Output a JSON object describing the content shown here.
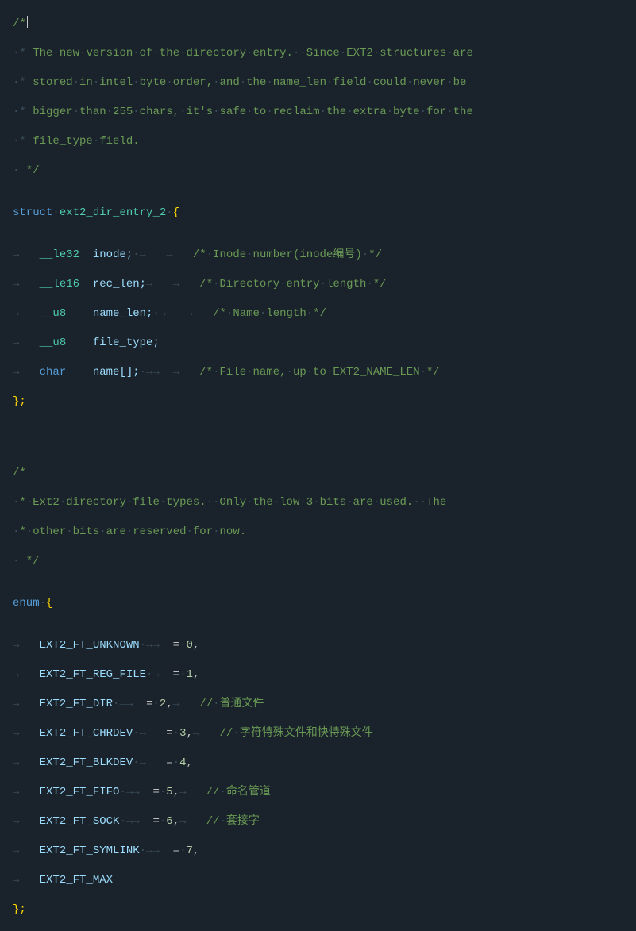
{
  "ws": {
    "dot": "·",
    "tab": "→",
    "tabs": "→→"
  },
  "cursor": "|",
  "l1": "/*",
  "l2": " * The new version of the directory entry.  Since EXT2 structures are",
  "l3": " * stored in intel byte order, and the name_len field could never be",
  "l4": " * bigger than 255 chars, it's safe to reclaim the extra byte for the",
  "l5": " * file_type field.",
  "l6": " */",
  "struct": {
    "kw_struct": "struct",
    "name": "ext2_dir_entry_2"
  },
  "brace_open": "{",
  "brace_close_semi": "};",
  "f1": {
    "type": "__le32",
    "name": "inode;",
    "cmt": "/* Inode number(inode编号) */"
  },
  "f2": {
    "type": "__le16",
    "name": "rec_len;",
    "cmt": "/* Directory entry length */"
  },
  "f3": {
    "type": "__u8",
    "name": "name_len;",
    "cmt": "/* Name length */"
  },
  "f4": {
    "type": "__u8",
    "name": "file_type;"
  },
  "f5": {
    "kw": "char",
    "name": "name[];",
    "cmt": "/* File name, up to EXT2_NAME_LEN */"
  },
  "c2l1": "/*",
  "c2l2": " * Ext2 directory file types.  Only the low 3 bits are used.  The",
  "c2l3": " * other bits are reserved for now.",
  "c2l4": " */",
  "enum_kw": "enum",
  "e0": {
    "name": "EXT2_FT_UNKNOWN",
    "eq": "=",
    "val": "0",
    "comma": ","
  },
  "e1": {
    "name": "EXT2_FT_REG_FILE",
    "eq": "=",
    "val": "1",
    "comma": ","
  },
  "e2": {
    "name": "EXT2_FT_DIR",
    "eq": "=",
    "val": "2",
    "comma": ",",
    "cmt": "// 普通文件"
  },
  "e3": {
    "name": "EXT2_FT_CHRDEV",
    "eq": "=",
    "val": "3",
    "comma": ",",
    "cmt": "// 字符特殊文件和快特殊文件"
  },
  "e4": {
    "name": "EXT2_FT_BLKDEV",
    "eq": "=",
    "val": "4",
    "comma": ","
  },
  "e5": {
    "name": "EXT2_FT_FIFO",
    "eq": "=",
    "val": "5",
    "comma": ",",
    "cmt": "// 命名管道"
  },
  "e6": {
    "name": "EXT2_FT_SOCK",
    "eq": "=",
    "val": "6",
    "comma": ",",
    "cmt": "// 套接字"
  },
  "e7": {
    "name": "EXT2_FT_SYMLINK",
    "eq": "=",
    "val": "7",
    "comma": ","
  },
  "e8": {
    "name": "EXT2_FT_MAX"
  }
}
